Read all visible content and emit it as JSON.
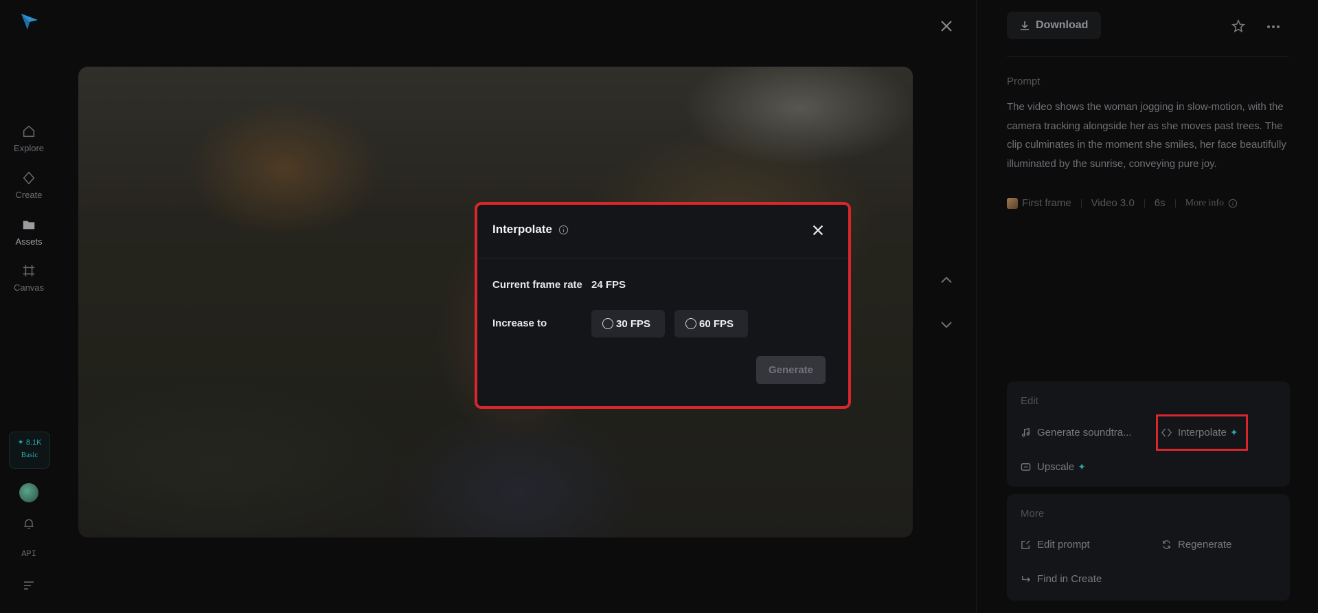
{
  "nav": {
    "items": [
      {
        "label": "Explore",
        "icon": "home-icon"
      },
      {
        "label": "Create",
        "icon": "diamond-icon"
      },
      {
        "label": "Assets",
        "icon": "folder-icon"
      },
      {
        "label": "Canvas",
        "icon": "grid-icon"
      }
    ],
    "credits": {
      "amount": "✦ 8.1K",
      "plan": "Basic"
    },
    "api_label": "API"
  },
  "modal": {
    "title": "Interpolate",
    "current_label": "Current frame rate",
    "current_value": "24 FPS",
    "increase_label": "Increase to",
    "options": [
      "30 FPS",
      "60 FPS"
    ],
    "generate_label": "Generate"
  },
  "right": {
    "download_label": "Download",
    "prompt_label": "Prompt",
    "prompt_text": "The video shows the woman jogging in slow-motion, with the camera tracking alongside her as she moves past trees. The clip culminates in the moment she smiles, her face beautifully illuminated by the sunrise, conveying pure joy.",
    "meta": {
      "first_frame": "First frame",
      "model": "Video 3.0",
      "duration": "6s",
      "more_info": "More info"
    },
    "edit": {
      "label": "Edit",
      "generate_soundtrack": "Generate soundtra...",
      "interpolate": "Interpolate",
      "upscale": "Upscale"
    },
    "more": {
      "label": "More",
      "edit_prompt": "Edit prompt",
      "regenerate": "Regenerate",
      "find_in_create": "Find in Create"
    }
  },
  "colors": {
    "accent": "#2aa5a8",
    "highlight": "#d8262d",
    "background": "#0c0c0d",
    "modal": "#141518"
  }
}
